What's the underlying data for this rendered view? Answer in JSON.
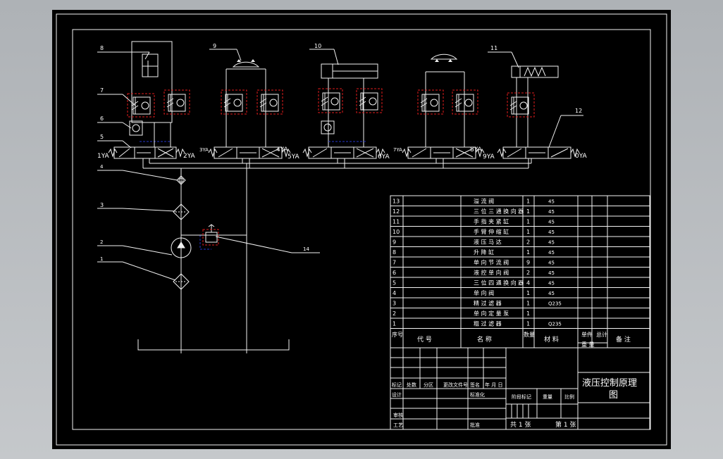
{
  "drawing": {
    "title_line1": "液压控制原理",
    "title_line2": "图"
  },
  "leaders": [
    {
      "label": "8"
    },
    {
      "label": "9"
    },
    {
      "label": "10"
    },
    {
      "label": "11"
    },
    {
      "label": "12"
    },
    {
      "label": "7"
    },
    {
      "label": "6"
    },
    {
      "label": "5"
    },
    {
      "label": "4"
    },
    {
      "label": "3"
    },
    {
      "label": "2"
    },
    {
      "label": "1"
    },
    {
      "label": "14"
    }
  ],
  "solenoids": [
    "1YA",
    "2YA",
    "3YA",
    "4YA",
    "5YA",
    "6YA",
    "7YA",
    "8YA",
    "9YA",
    "0YA"
  ],
  "bom": {
    "rows": [
      {
        "no": "13",
        "name": "溢 流 阀",
        "qty": "1",
        "material": "45"
      },
      {
        "no": "12",
        "name": "三 位 三 通 换 向 器",
        "qty": "1",
        "material": "45"
      },
      {
        "no": "11",
        "name": "手 指 夹 紧 缸",
        "qty": "1",
        "material": "45"
      },
      {
        "no": "10",
        "name": "手 臂 伸 缩 缸",
        "qty": "1",
        "material": "45"
      },
      {
        "no": "9",
        "name": "液 压 马 达",
        "qty": "2",
        "material": "45"
      },
      {
        "no": "8",
        "name": "升 降 缸",
        "qty": "1",
        "material": "45"
      },
      {
        "no": "7",
        "name": "单 向 节 流 阀",
        "qty": "9",
        "material": "45"
      },
      {
        "no": "6",
        "name": "液 控 单 向 阀",
        "qty": "2",
        "material": "45"
      },
      {
        "no": "5",
        "name": "三 位 四 通 换 向 器",
        "qty": "4",
        "material": "45"
      },
      {
        "no": "4",
        "name": "单 向 阀",
        "qty": "1",
        "material": "45"
      },
      {
        "no": "3",
        "name": "精 过 滤 器",
        "qty": "1",
        "material": "Q235"
      },
      {
        "no": "2",
        "name": "单 向 定 量 泵",
        "qty": "1",
        "material": ""
      },
      {
        "no": "1",
        "name": "粗 过 滤 器",
        "qty": "1",
        "material": "Q235"
      }
    ],
    "header": {
      "seq": "序号",
      "code": "代 号",
      "name": "名 称",
      "qty": "数量",
      "material": "材 料",
      "single": "单件",
      "total": "总计",
      "weight": "重 量",
      "remark": "备 注"
    }
  },
  "title_block": {
    "mark": "标记",
    "count": "处数",
    "zone": "分区",
    "change_doc": "更改文件号",
    "signature": "签名",
    "date": "年 月 日",
    "designer": "设计",
    "standard": "标准化",
    "stage_mark": "阶段标记",
    "weight": "重量",
    "scale": "比例",
    "review": "审核",
    "process": "工艺",
    "approve": "批准",
    "sheets_total": "共 1 张",
    "sheet_no": "第 1 张"
  }
}
